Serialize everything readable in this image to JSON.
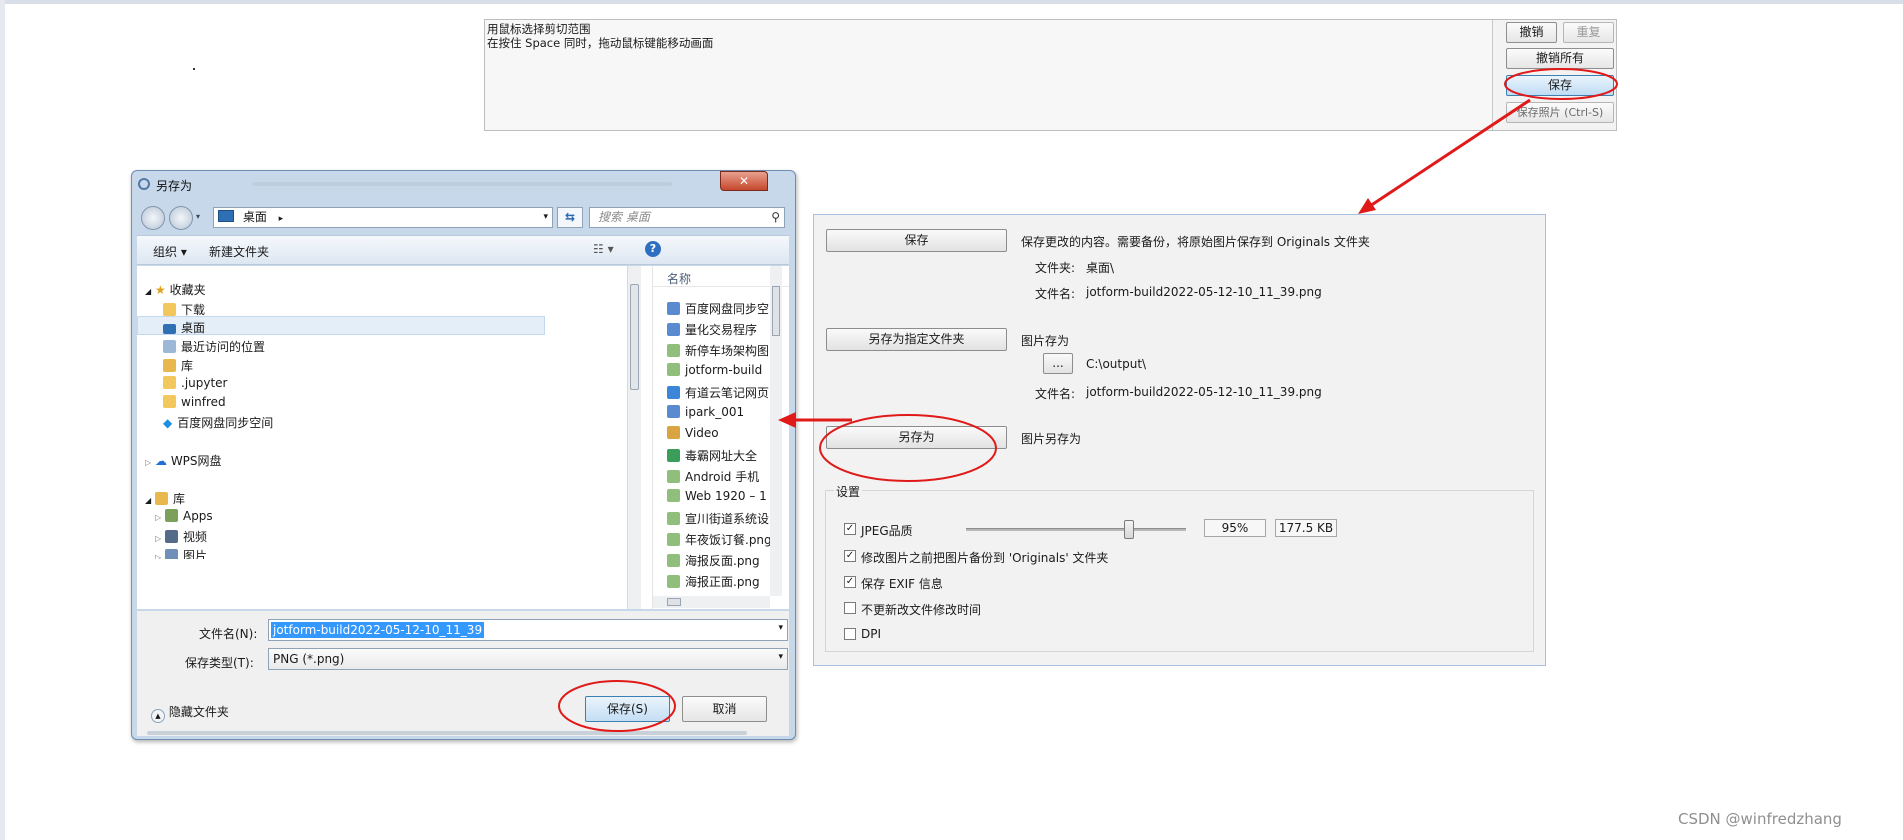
{
  "top_panel": {
    "instructions": [
      "用鼠标选择剪切范围",
      "在按住 Space 同时，拖动鼠标键能移动画面"
    ],
    "undo": "撤销",
    "redo": "重复",
    "undo_all": "撤销所有",
    "save": "保存",
    "save_photo": "保存照片 (Ctrl-S)"
  },
  "dialog": {
    "title": "另存为",
    "close": "✕",
    "address": "桌面",
    "search_placeholder": "搜索 桌面",
    "organize": "组织 ▾",
    "new_folder": "新建文件夹",
    "nav_items": [
      {
        "label": "收藏夹",
        "icon": "star-icon"
      },
      {
        "label": "下载",
        "icon": "folder-icon"
      },
      {
        "label": "桌面",
        "icon": "desktop-icon"
      },
      {
        "label": "最近访问的位置",
        "icon": "recent-icon"
      },
      {
        "label": "库",
        "icon": "library-icon"
      },
      {
        "label": ".jupyter",
        "icon": "folder-icon"
      },
      {
        "label": "winfred",
        "icon": "folder-icon"
      },
      {
        "label": "百度网盘同步空间",
        "icon": "baidu-icon"
      },
      {
        "label": "WPS网盘",
        "icon": "cloud-icon"
      },
      {
        "label": "库",
        "icon": "library-icon"
      },
      {
        "label": "Apps",
        "icon": "library-folder-icon"
      },
      {
        "label": "视频",
        "icon": "video-icon"
      },
      {
        "label": "图片",
        "icon": "picture-icon"
      }
    ],
    "list_header": "名称",
    "files": [
      {
        "label": "百度网盘同步空",
        "icon": "shortcut-icon"
      },
      {
        "label": "量化交易程序",
        "icon": "shortcut-icon"
      },
      {
        "label": "新停车场架构图",
        "icon": "image-icon"
      },
      {
        "label": "jotform-build",
        "icon": "image-icon"
      },
      {
        "label": "有道云笔记网页",
        "icon": "shortcut-icon"
      },
      {
        "label": "ipark_001",
        "icon": "shortcut-icon"
      },
      {
        "label": "Video",
        "icon": "shortcut-icon"
      },
      {
        "label": "毒霸网址大全",
        "icon": "shortcut-icon"
      },
      {
        "label": "Android 手机",
        "icon": "image-icon"
      },
      {
        "label": "Web 1920 – 1",
        "icon": "image-icon"
      },
      {
        "label": "宣川街道系统设",
        "icon": "image-icon"
      },
      {
        "label": "年夜饭订餐.png",
        "icon": "image-icon"
      },
      {
        "label": "海报反面.png",
        "icon": "image-icon"
      },
      {
        "label": "海报正面.png",
        "icon": "image-icon"
      }
    ],
    "filename_label": "文件名(N):",
    "filename_value": "jotform-build2022-05-12-10_11_39",
    "filetype_label": "保存类型(T):",
    "filetype_value": "PNG (*.png)",
    "hide_folders": "隐藏文件夹",
    "save_button": "保存(S)",
    "cancel_button": "取消"
  },
  "options": {
    "save_button": "保存",
    "save_desc": "保存更改的内容。需要备份，将原始图片保存到 Originals 文件夹",
    "folder_label": "文件夹:",
    "folder_value": "桌面\\",
    "filename_label": "文件名:",
    "filename_value": "jotform-build2022-05-12-10_11_39.png",
    "save_to_folder_button": "另存为指定文件夹",
    "save_to_desc": "图片存为",
    "browse_button": "...",
    "output_path": "C:\\output\\",
    "filename2_label": "文件名:",
    "filename2_value": "jotform-build2022-05-12-10_11_39.png",
    "save_as_button": "另存为",
    "save_as_desc": "图片另存为",
    "settings_label": "设置",
    "jpeg_quality_label": "JPEG品质",
    "jpeg_quality_value": "95%",
    "jpeg_quality_fraction": 0.75,
    "file_size": "177.5 KB",
    "checkboxes": [
      {
        "label": "JPEG品质",
        "checked": true
      },
      {
        "label": "修改图片之前把图片备份到 'Originals' 文件夹",
        "checked": true
      },
      {
        "label": "保存 EXIF 信息",
        "checked": true
      },
      {
        "label": "不更新改文件修改时间",
        "checked": false
      },
      {
        "label": "DPI",
        "checked": false
      }
    ]
  },
  "colors": {
    "annotation_red": "#e01919",
    "dialog_frame": "#c7d8ea",
    "selection_blue": "#3399ff"
  },
  "watermark": "CSDN @winfredzhang"
}
